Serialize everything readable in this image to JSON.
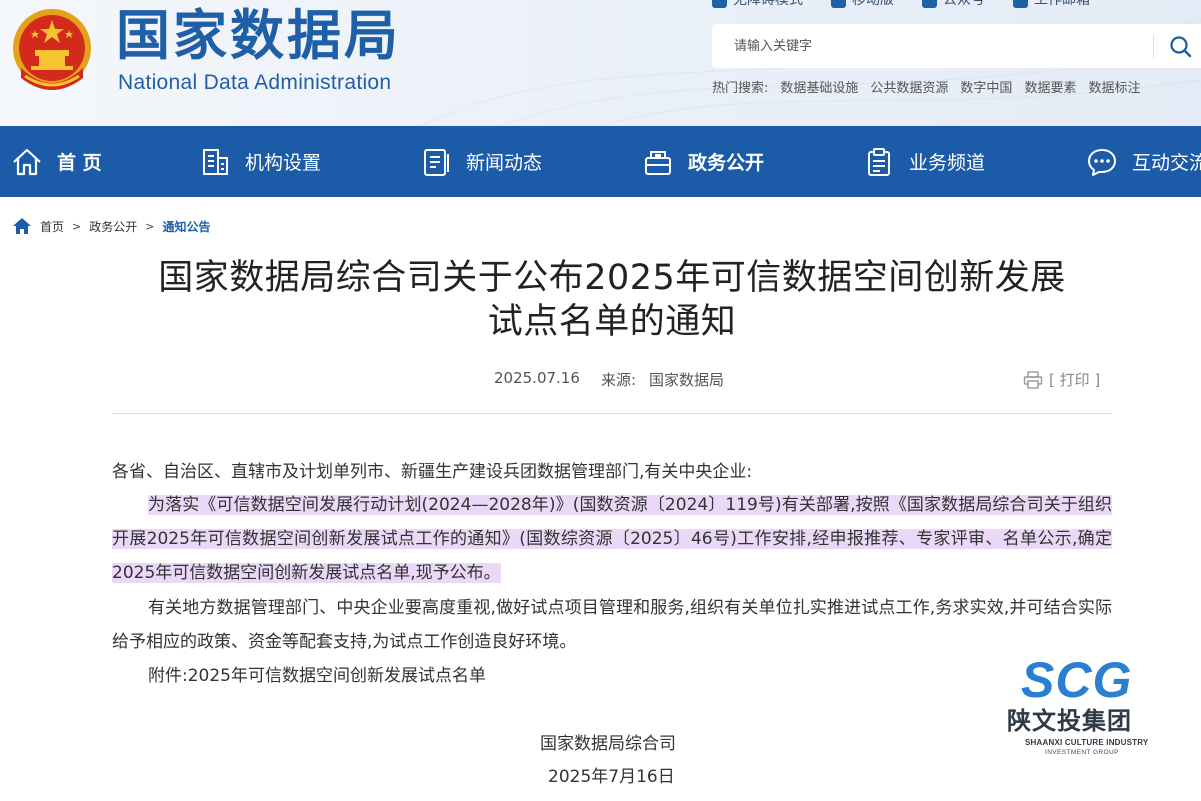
{
  "header": {
    "title_cn": "国家数据局",
    "title_en": "National Data Administration",
    "toplinks": [
      {
        "label": "无障碍模式",
        "icon": "accessibility-icon"
      },
      {
        "label": "移动版",
        "icon": "mobile-icon"
      },
      {
        "label": "公众号",
        "icon": "wechat-icon"
      },
      {
        "label": "工作邮箱",
        "icon": "mail-icon"
      }
    ],
    "search": {
      "placeholder": "请输入关键字",
      "icon": "search-icon"
    },
    "hot": {
      "label": "热门搜索:",
      "items": [
        "数据基础设施",
        "公共数据资源",
        "数字中国",
        "数据要素",
        "数据标注"
      ]
    }
  },
  "nav": {
    "items": [
      {
        "label": "首 页",
        "icon": "home-icon"
      },
      {
        "label": "机构设置",
        "icon": "building-icon"
      },
      {
        "label": "新闻动态",
        "icon": "news-icon"
      },
      {
        "label": "政务公开",
        "icon": "government-affairs-icon"
      },
      {
        "label": "业务频道",
        "icon": "clipboard-icon"
      },
      {
        "label": "互动交流",
        "icon": "chat-icon"
      }
    ]
  },
  "breadcrumb": {
    "items": [
      "首页",
      "政务公开",
      "通知公告"
    ],
    "separator": ">"
  },
  "article": {
    "title_line1": "国家数据局综合司关于公布2025年可信数据空间创新发展",
    "title_line2": "试点名单的通知",
    "date": "2025.07.16",
    "source_label": "来源:",
    "source": "国家数据局",
    "print_label": "[ 打印 ]",
    "salutation": "各省、自治区、直辖市及计划单列市、新疆生产建设兵团数据管理部门,有关中央企业:",
    "paragraph1": "为落实《可信数据空间发展行动计划(2024—2028年)》(国数资源〔2024〕119号)有关部署,按照《国家数据局综合司关于组织开展2025年可信数据空间创新发展试点工作的通知》(国数综资源〔2025〕46号)工作安排,经申报推荐、专家评审、名单公示,确定2025年可信数据空间创新发展试点名单,现予公布。",
    "paragraph2": "有关地方数据管理部门、中央企业要高度重视,做好试点项目管理和服务,组织有关单位扎实推进试点工作,务求实效,并可结合实际给予相应的政策、资金等配套支持,为试点工作创造良好环境。",
    "attachment": "附件:2025年可信数据空间创新发展试点名单",
    "signature": "国家数据局综合司",
    "sign_date": "2025年7月16日"
  },
  "watermark": {
    "brand": "SCG",
    "name_cn": "陕文投集团",
    "name_en1": "SHAANXI CULTURE INDUSTRY",
    "name_en2": "INVESTMENT GROUP"
  },
  "colors": {
    "brand_blue": "#1b5ba7",
    "highlight": "#ead8f6",
    "watermark_blue": "#2a7fd1"
  }
}
